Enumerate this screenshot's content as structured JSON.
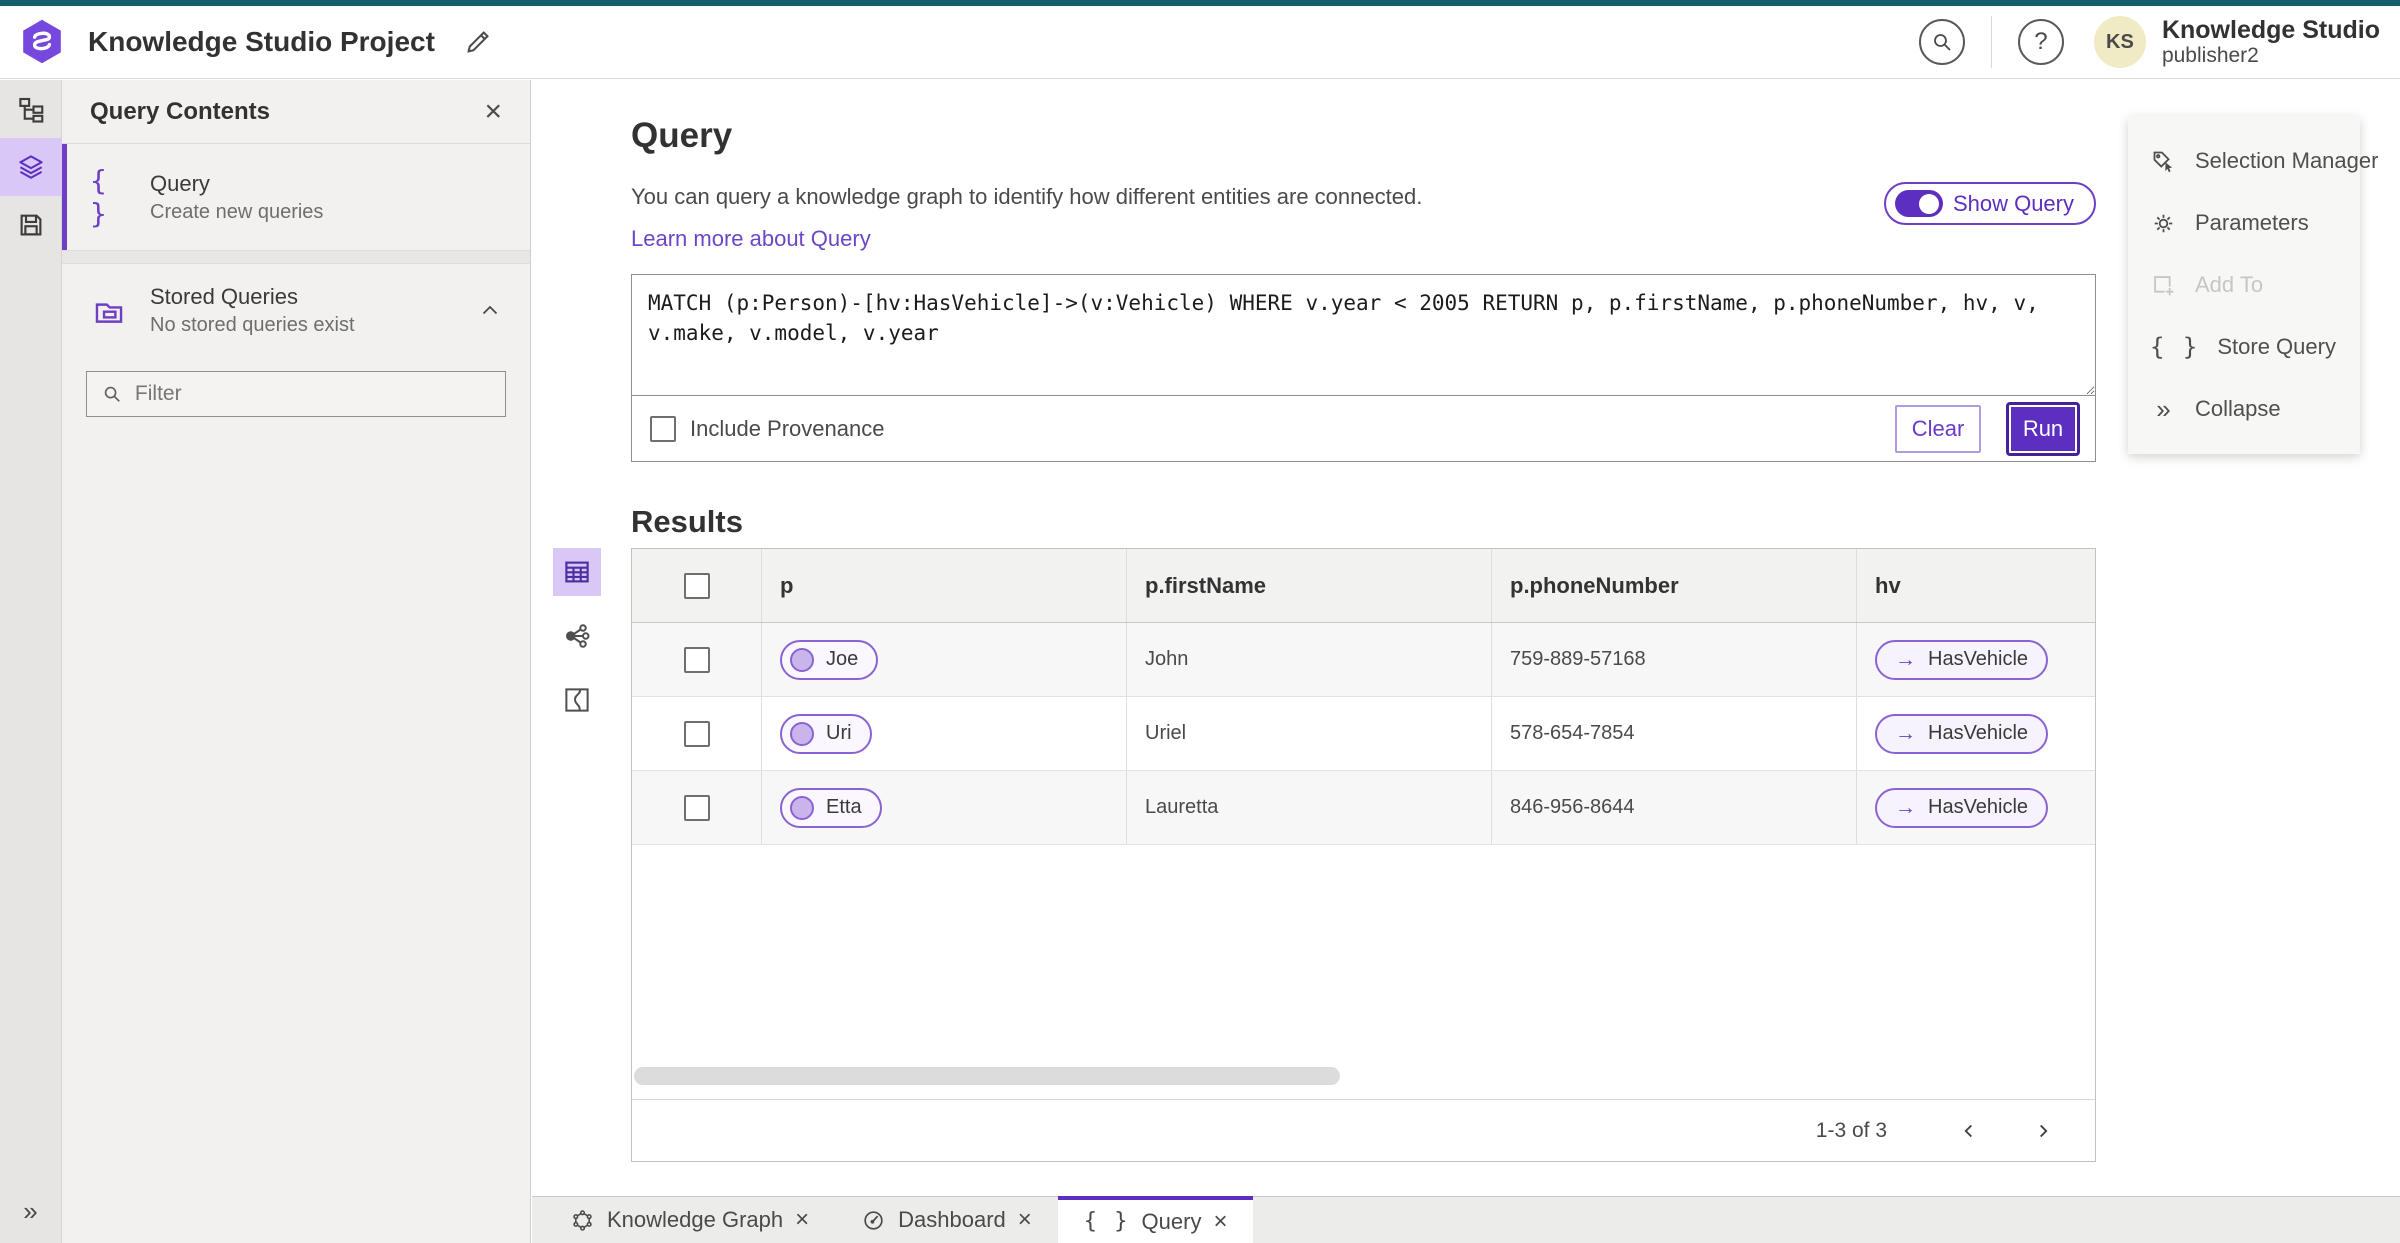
{
  "header": {
    "app_title": "Knowledge Studio Project",
    "user_name": "Knowledge Studio",
    "user_role": "publisher2",
    "avatar_initials": "KS"
  },
  "left_panel": {
    "title": "Query Contents",
    "query_item": {
      "title": "Query",
      "subtitle": "Create new queries"
    },
    "stored_item": {
      "title": "Stored Queries",
      "subtitle": "No stored queries exist"
    },
    "filter_placeholder": "Filter"
  },
  "main": {
    "title": "Query",
    "description": "You can query a knowledge graph to identify how different entities are connected.",
    "learn_more": "Learn more about Query",
    "show_query_label": "Show Query",
    "query_text": "MATCH (p:Person)-[hv:HasVehicle]->(v:Vehicle) WHERE v.year < 2005 RETURN p, p.firstName, p.phoneNumber, hv, v, v.make, v.model, v.year",
    "include_provenance_label": "Include Provenance",
    "clear_label": "Clear",
    "run_label": "Run",
    "results_title": "Results"
  },
  "table": {
    "columns": [
      "p",
      "p.firstName",
      "p.phoneNumber",
      "hv"
    ],
    "rows": [
      {
        "p": "Joe",
        "firstName": "John",
        "phoneNumber": "759-889-57168",
        "hv": "HasVehicle"
      },
      {
        "p": "Uri",
        "firstName": "Uriel",
        "phoneNumber": "578-654-7854",
        "hv": "HasVehicle"
      },
      {
        "p": "Etta",
        "firstName": "Lauretta",
        "phoneNumber": "846-956-8644",
        "hv": "HasVehicle"
      }
    ],
    "rel_arrow": "→",
    "pagination": "1-3 of 3"
  },
  "right_panel": {
    "items": [
      {
        "label": "Selection Manager"
      },
      {
        "label": "Parameters"
      },
      {
        "label": "Add To"
      },
      {
        "label": "Store Query"
      },
      {
        "label": "Collapse"
      }
    ]
  },
  "bottom_tabs": [
    {
      "label": "Knowledge Graph"
    },
    {
      "label": "Dashboard"
    },
    {
      "label": "Query"
    }
  ],
  "glyphs": {
    "brace": "{ }",
    "close": "×",
    "expand": "»",
    "help": "?"
  },
  "colors": {
    "accent_purple": "#5d2fc0",
    "top_strip_teal": "#14616b",
    "active_icon_bg": "#d9c7f7",
    "avatar_bg": "#f0ebc4"
  }
}
